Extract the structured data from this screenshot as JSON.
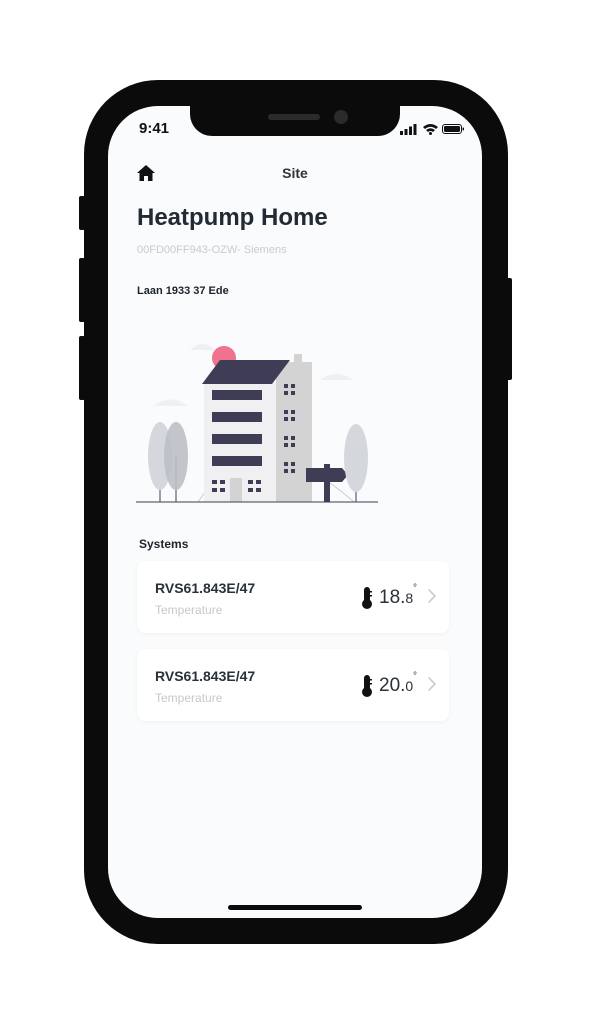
{
  "status_bar": {
    "time": "9:41",
    "icons": [
      "signal-icon",
      "wifi-icon",
      "battery-icon"
    ]
  },
  "nav": {
    "home_icon": "home-icon",
    "title": "Site"
  },
  "site": {
    "name": "Heatpump Home",
    "id": "00FD00FF943-OZW- Siemens",
    "address": "Laan 1933 37 Ede"
  },
  "systems": {
    "label": "Systems",
    "items": [
      {
        "name": "RVS61.843E/47",
        "subtitle": "Temperature",
        "temp_int": "18.",
        "temp_dec": "8",
        "degree": "°"
      },
      {
        "name": "RVS61.843E/47",
        "subtitle": "Temperature",
        "temp_int": "20.",
        "temp_dec": "0",
        "degree": "°"
      }
    ]
  },
  "colors": {
    "building_accent": "#3f3d56",
    "sun": "#f0728c",
    "background": "#f9fbfc",
    "card": "#ffffff"
  }
}
